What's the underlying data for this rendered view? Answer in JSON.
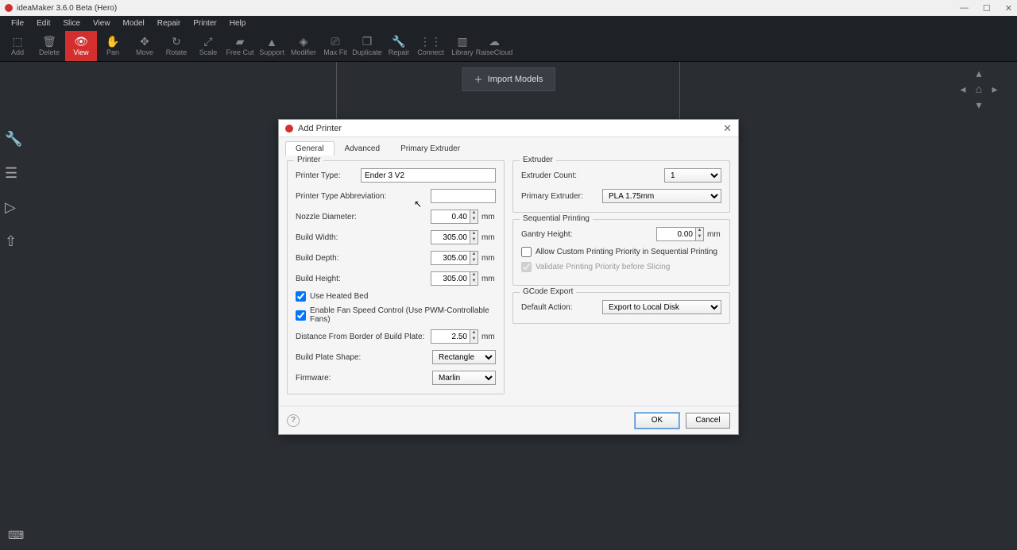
{
  "app": {
    "title": "ideaMaker 3.6.0 Beta (Hero)"
  },
  "menu": [
    "File",
    "Edit",
    "Slice",
    "View",
    "Model",
    "Repair",
    "Printer",
    "Help"
  ],
  "tools": [
    {
      "label": "Add",
      "icon": "⬚"
    },
    {
      "label": "Delete",
      "icon": "🗑"
    },
    {
      "label": "View",
      "icon": "👁",
      "active": true
    },
    {
      "label": "Pan",
      "icon": "✋"
    },
    {
      "label": "Move",
      "icon": "✥"
    },
    {
      "label": "Rotate",
      "icon": "↻"
    },
    {
      "label": "Scale",
      "icon": "⤢"
    },
    {
      "label": "Free Cut",
      "icon": "▰"
    },
    {
      "label": "Support",
      "icon": "▲"
    },
    {
      "label": "Modifier",
      "icon": "◈"
    },
    {
      "label": "Max Fit",
      "icon": "⎚"
    },
    {
      "label": "Duplicate",
      "icon": "❐"
    },
    {
      "label": "Repair",
      "icon": "🔧"
    },
    {
      "label": "Connect",
      "icon": "⋮⋮"
    },
    {
      "label": "Library",
      "icon": "▥"
    },
    {
      "label": "RaiseCloud",
      "icon": "☁"
    }
  ],
  "import_button": "Import Models",
  "dialog": {
    "title": "Add Printer",
    "tabs": [
      "General",
      "Advanced",
      "Primary Extruder"
    ],
    "active_tab": 0,
    "printer_group": "Printer",
    "extruder_group": "Extruder",
    "seq_group": "Sequential Printing",
    "gcode_group": "GCode Export",
    "labels": {
      "printer_type": "Printer Type:",
      "abbr": "Printer Type Abbreviation:",
      "nozzle": "Nozzle Diameter:",
      "bwidth": "Build Width:",
      "bdepth": "Build Depth:",
      "bheight": "Build Height:",
      "heated": "Use Heated Bed",
      "fan": "Enable Fan Speed Control (Use PWM-Controllable Fans)",
      "dist": "Distance From Border of Build Plate:",
      "shape": "Build Plate Shape:",
      "firmware": "Firmware:",
      "excount": "Extruder Count:",
      "primex": "Primary Extruder:",
      "gantry": "Gantry Height:",
      "allowcustom": "Allow Custom Printing Priority in Sequential Printing",
      "validate": "Validate Printing Priority before Slicing",
      "defaction": "Default Action:"
    },
    "values": {
      "printer_type": "Ender 3 V2",
      "abbr": "",
      "nozzle": "0.40",
      "bwidth": "305.00",
      "bdepth": "305.00",
      "bheight": "305.00",
      "dist": "2.50",
      "shape": "Rectangle",
      "firmware": "Marlin",
      "excount": "1",
      "primex": "PLA 1.75mm",
      "gantry": "0.00",
      "defaction": "Export to Local Disk"
    },
    "unit_mm": "mm",
    "ok": "OK",
    "cancel": "Cancel"
  }
}
